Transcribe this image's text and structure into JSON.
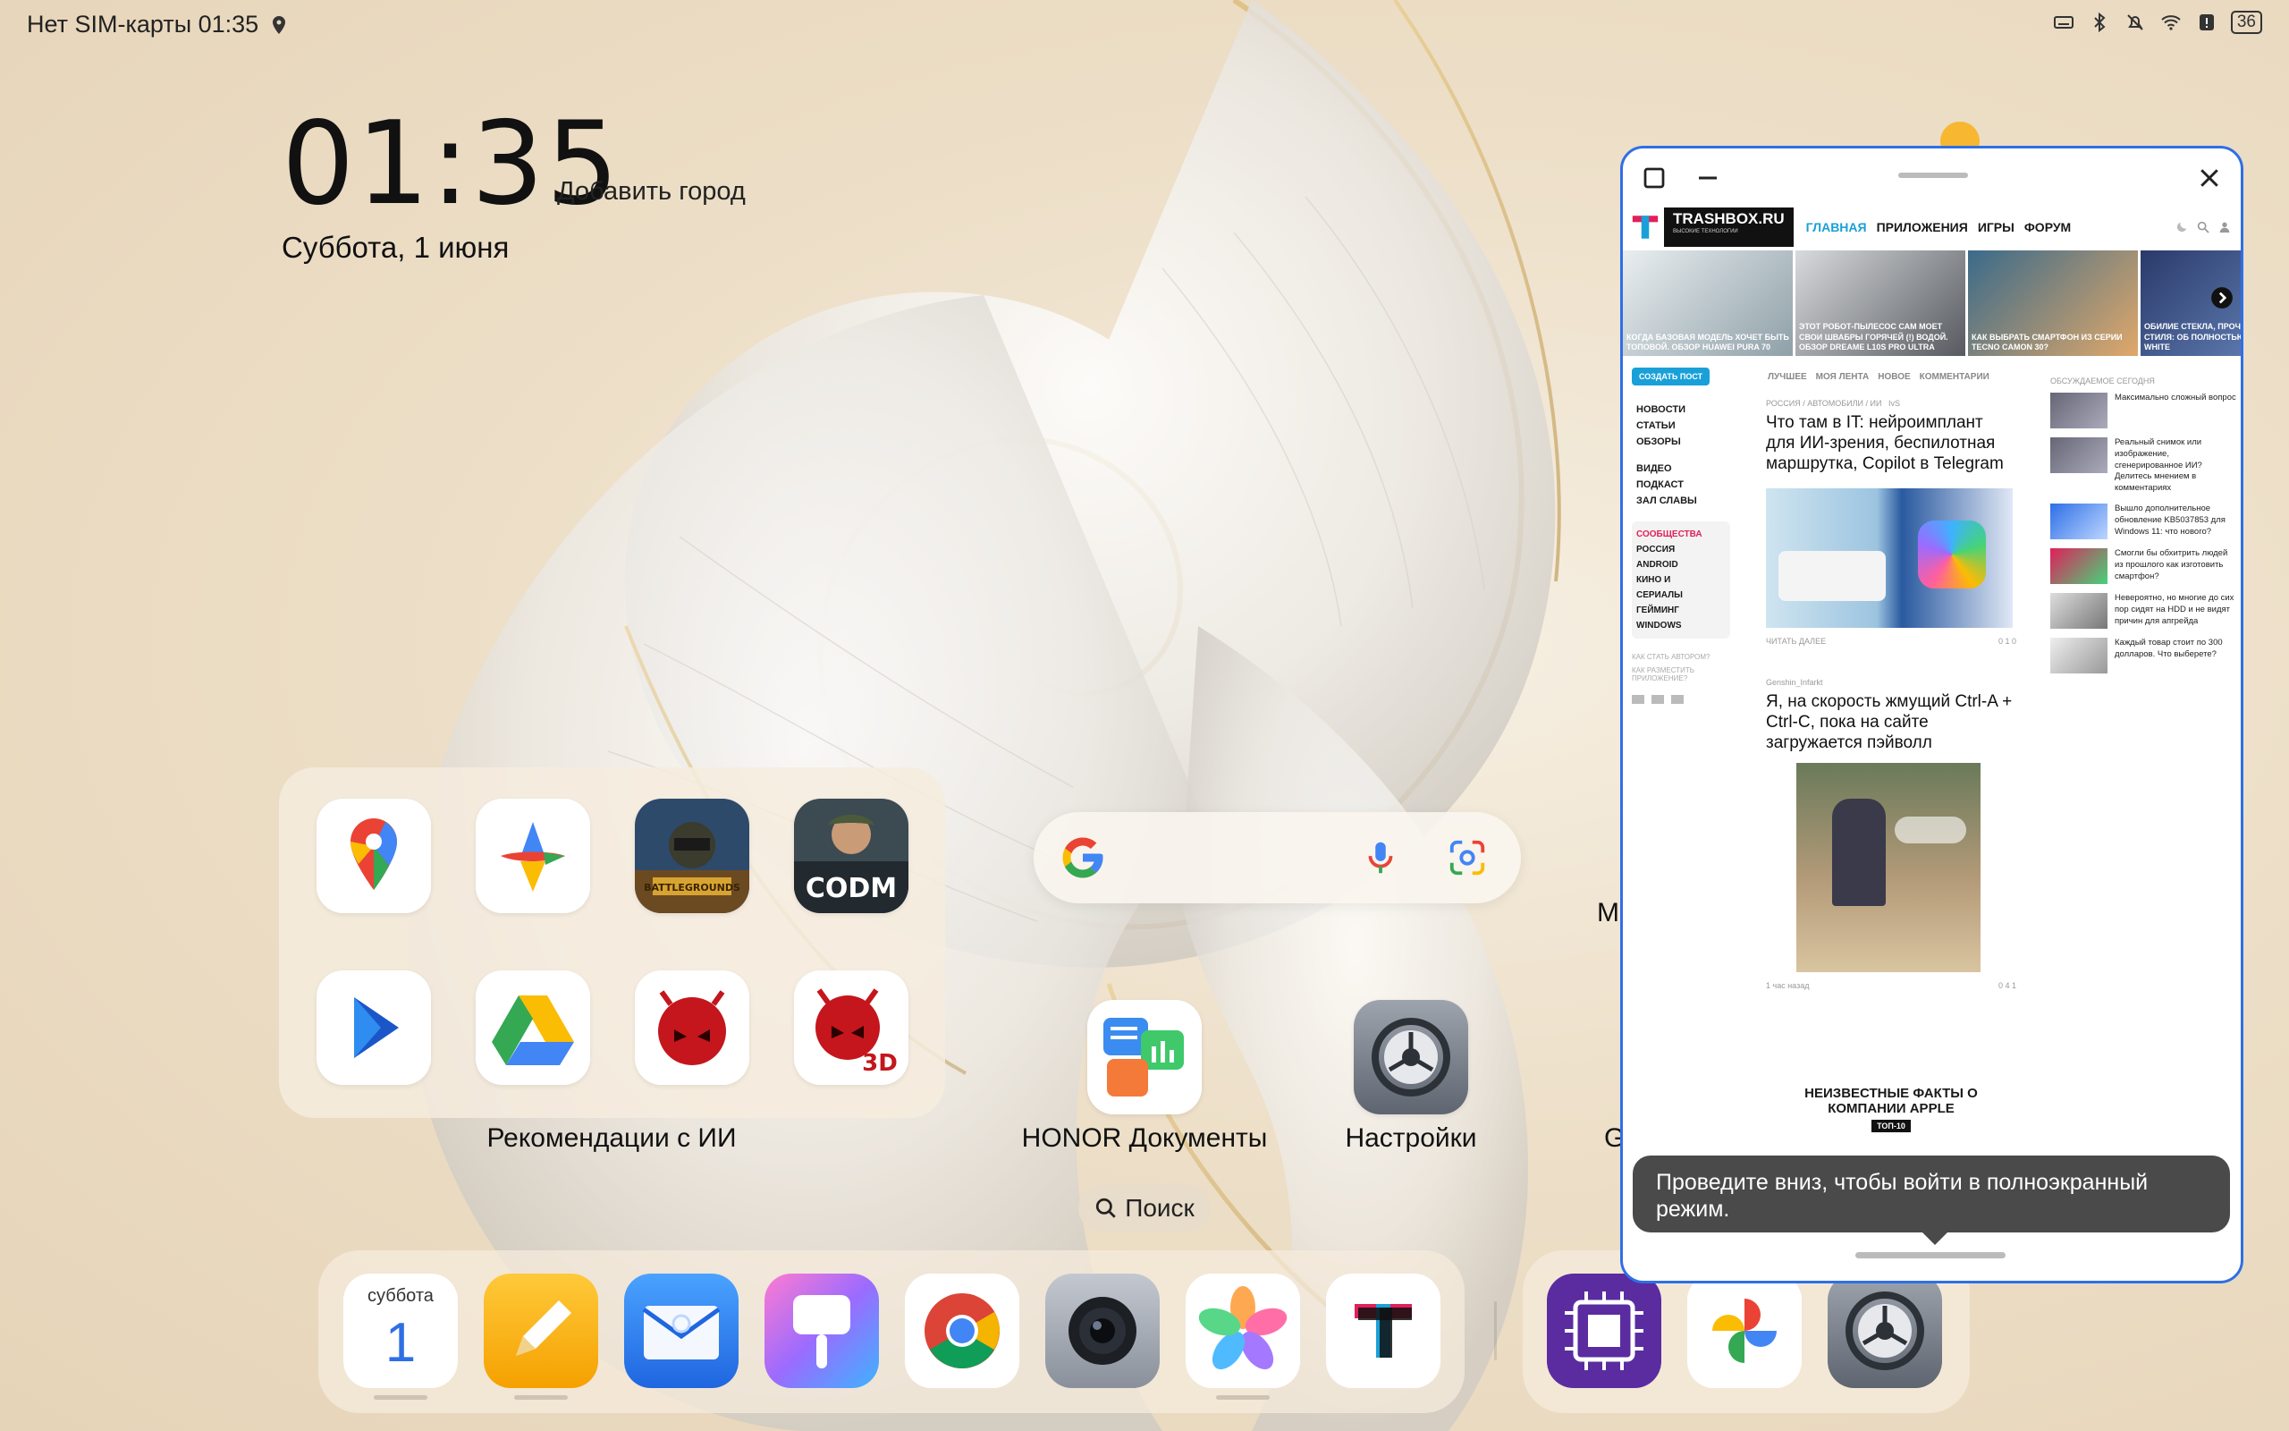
{
  "status": {
    "carrier_time": "Нет SIM-карты 01:35",
    "battery": "36"
  },
  "clock": {
    "time": "01:35",
    "add_city": "Добавить город",
    "date": "Суббота, 1 июня"
  },
  "folder": {
    "label": "Рекомендации с ИИ",
    "apps": [
      "google-maps",
      "google-one",
      "pubg-mobile",
      "codm",
      "play-video",
      "google-drive",
      "antutu",
      "antutu-3d"
    ]
  },
  "home_apps": {
    "docs_label": "HONOR Документы",
    "settings_label": "Настройки",
    "partial_m": "M",
    "partial_g": "G"
  },
  "search_pill": {
    "label": "Поиск"
  },
  "dock": {
    "calendar_day_name": "суббота",
    "calendar_day_num": "1"
  },
  "floating_window": {
    "site": {
      "logo": "TRASHBOX.RU",
      "logo_sub": "ВЫСОКИЕ ТЕХНОЛОГИИ",
      "nav": [
        "ГЛАВНАЯ",
        "ПРИЛОЖЕНИЯ",
        "ИГРЫ",
        "ФОРУМ"
      ],
      "carousel": [
        "КОГДА БАЗОВАЯ МОДЕЛЬ ХОЧЕТ БЫТЬ ТОПОВОЙ. ОБЗОР HUAWEI PURA 70",
        "ЭТОТ РОБОТ-ПЫЛЕСОС САМ МОЕТ СВОИ ШВАБРЫ ГОРЯЧЕЙ (!) ВОДОЙ. ОБЗОР DREAME L10S PRO ULTRA",
        "КАК ВЫБРАТЬ СМАРТФОН ИЗ СЕРИИ TECNO CAMON 30?",
        "ОБИЛИЕ СТЕКЛА, ПРОЧ МЕТАЛЛА И СТИЛЯ: ОБ ПОЛНОСТЬЮ БЕЛОГО Z WHITE"
      ],
      "create_post": "СОЗДАТЬ ПОСТ",
      "left_nav": [
        "НОВОСТИ",
        "СТАТЬИ",
        "ОБЗОРЫ",
        "ВИДЕО",
        "ПОДКАСТ",
        "ЗАЛ СЛАВЫ"
      ],
      "communities_title": "СООБЩЕСТВА",
      "communities": [
        "РОССИЯ",
        "ANDROID",
        "КИНО И",
        "СЕРИАЛЫ",
        "ГЕЙМИНГ",
        "WINDOWS"
      ],
      "left_links": [
        "КАК СТАТЬ АВТОРОМ?",
        "КАК РАЗМЕСТИТЬ ПРИЛОЖЕНИЕ?"
      ],
      "tabs": [
        "ЛУЧШЕЕ",
        "МОЯ ЛЕНТА",
        "НОВОЕ",
        "КОММЕНТАРИИ"
      ],
      "post1": {
        "meta": "РОССИЯ / АВТОМОБИЛИ / ИИ",
        "author": "IvS",
        "title": "Что там в IT: нейроимплант для ИИ-зрения, беспилотная маршрутка, Copilot в Telegram",
        "read_more": "ЧИТАТЬ ДАЛЕЕ",
        "stats": "0   1   0"
      },
      "post2": {
        "author": "Genshin_Infarkt",
        "title": "Я, на скорость жмущий Ctrl-A + Ctrl-C, пока на сайте загружается пэйволл",
        "time": "1 час назад",
        "stats": "0   4   1"
      },
      "fact": {
        "title": "НЕИЗВЕСТНЫЕ ФАКТЫ О КОМПАНИИ APPLE",
        "tag": "ТОП-10"
      },
      "right_header": "ОБСУЖДАЕМОЕ СЕГОДНЯ",
      "right_items": [
        "Максимально сложный вопрос",
        "Реальный снимок или изображение, сгенерированное ИИ? Делитесь мнением в комментариях",
        "Вышло дополнительное обновление KB5037853 для Windows 11: что нового?",
        "Смогли бы обхитрить людей из прошлого как изготовить смартфон?",
        "Невероятно, но многие до сих пор сидят на HDD и не видят причин для апгрейда",
        "Каждый товар стоит по 300 долларов. Что выберете?"
      ]
    },
    "toast": "Проведите вниз, чтобы войти в полноэкранный режим."
  }
}
